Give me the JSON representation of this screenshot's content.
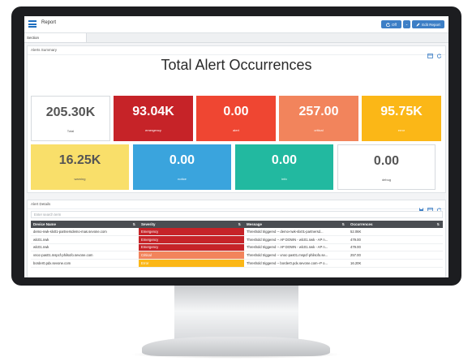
{
  "app": {
    "title": "Report"
  },
  "toolbar": {
    "off_label": "Off",
    "caret": "⌄",
    "edit_label": "Edit Report"
  },
  "tabs": [
    {
      "label": "Section"
    }
  ],
  "summary": {
    "panel_title": "Alerts Summary",
    "heading": "Total Alert Occurrences",
    "tiles": [
      {
        "value": "205.30K",
        "label": "Total",
        "color": "#ffffff",
        "style": "light"
      },
      {
        "value": "93.04K",
        "label": "emergency",
        "color": "#c62328",
        "style": "dark"
      },
      {
        "value": "0.00",
        "label": "alert",
        "color": "#ef4632",
        "style": "dark"
      },
      {
        "value": "257.00",
        "label": "critical",
        "color": "#f2845c",
        "style": "dark"
      },
      {
        "value": "95.75K",
        "label": "error",
        "color": "#fbb717",
        "style": "dark"
      },
      {
        "value": "16.25K",
        "label": "warning",
        "color": "#f9df6a",
        "style": "warn"
      },
      {
        "value": "0.00",
        "label": "notice",
        "color": "#3aa4dd",
        "style": "dark"
      },
      {
        "value": "0.00",
        "label": "info",
        "color": "#22b9a0",
        "style": "dark"
      },
      {
        "value": "0.00",
        "label": "debug",
        "color": "#ffffff",
        "style": "light"
      }
    ]
  },
  "details": {
    "panel_title": "Alert Details",
    "search_placeholder": "Enter search term",
    "columns": [
      "Device Name",
      "Severity",
      "Message",
      "Occurrences"
    ],
    "rows": [
      {
        "device": "demo-nwk-slx01-partnersdemo-mas.sevone.com",
        "severity": "Emergency",
        "sev_color": "#c62328",
        "message": "Threshold triggered -- demo-nwk-slx01-partnersd...",
        "count": "52.06K"
      },
      {
        "device": "wlc01.nwk",
        "severity": "Emergency",
        "sev_color": "#c62328",
        "message": "Threshold triggered -- AP DOWN - wlc01.nwk - AP n...",
        "count": "479.00"
      },
      {
        "device": "wlc01.nwk",
        "severity": "Emergency",
        "sev_color": "#c62328",
        "message": "Threshold triggered -- AP DOWN - wlc01.nwk - AP n...",
        "count": "479.00"
      },
      {
        "device": "vnoc-pas01.mspcf-philsofo.sevone.com",
        "severity": "Critical",
        "sev_color": "#f2845c",
        "message": "Threshold triggered -- vnoc-pas01.mspcf-philsofo.se...",
        "count": "257.00"
      },
      {
        "device": "border0.pdx.sevone.com",
        "severity": "Error",
        "sev_color": "#fbb717",
        "message": "Threshold triggered -- border0.pdx.sevone.com--P o...",
        "count": "16.20K"
      }
    ]
  }
}
